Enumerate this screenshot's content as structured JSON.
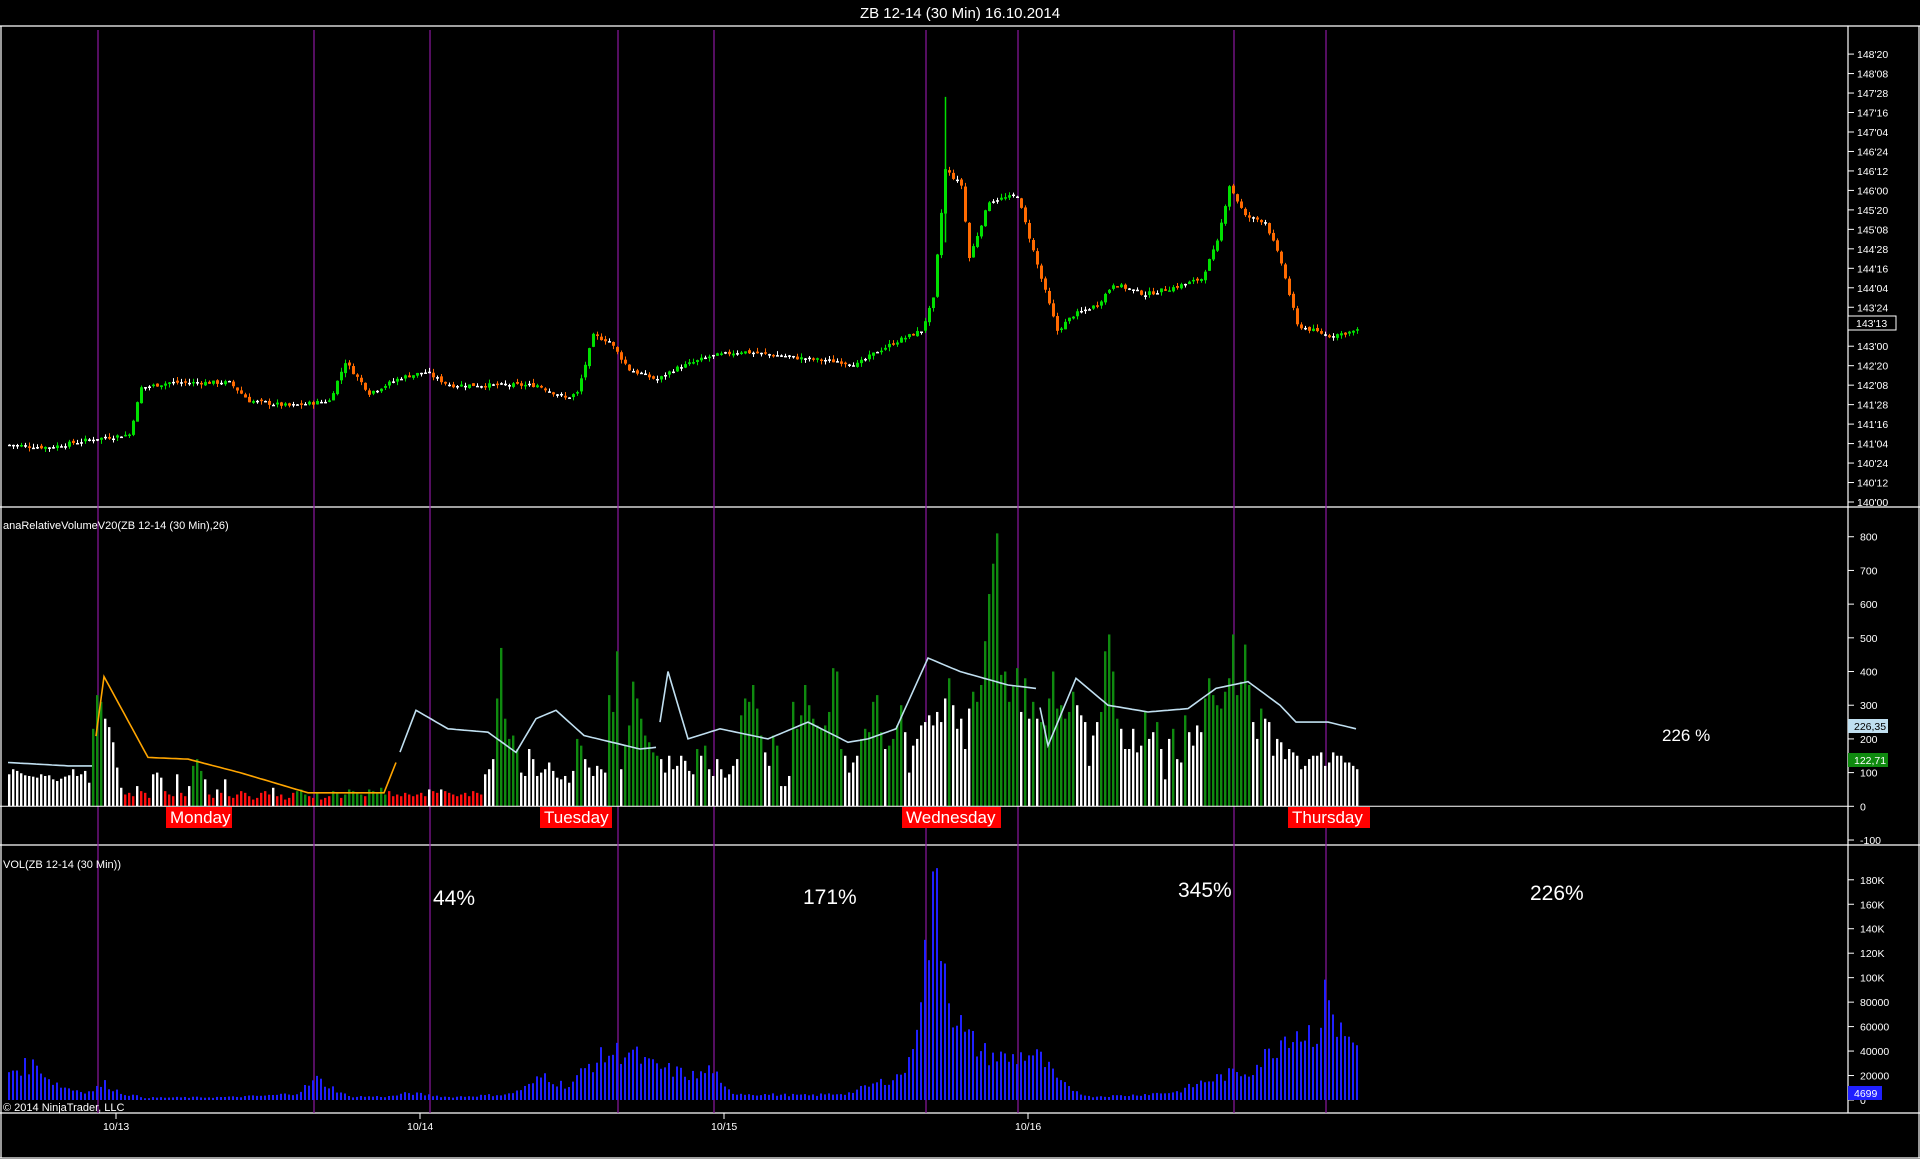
{
  "window": {
    "title": "ZB 12-14 (30 Min)  16.10.2014"
  },
  "copyright": "© 2014 NinjaTrader, LLC",
  "colors": {
    "background": "#000000",
    "up_candle": "#00e000",
    "down_candle": "#ff6a00",
    "flat_candle": "#ffffff",
    "session_line": "#8b18a0",
    "rel_vol_high": "#0f8a0f",
    "rel_vol_low": "#ff1010",
    "rel_vol_mid": "#ffffff",
    "rel_vol_avg_line": "#c0dff0",
    "rel_vol_avg_line_low": "#ffa500",
    "volume_bar": "#2020ff",
    "day_badge": "#ff0000"
  },
  "panels": {
    "price": {
      "last_price_badge": "143'13"
    },
    "relative_volume": {
      "label": "anaRelativeVolumeV20(ZB 12-14 (30 Min),26)",
      "avg_badge": "226,35",
      "value_badge": "122,71",
      "right_annotation": "226 %"
    },
    "volume": {
      "label": "VOL(ZB 12-14 (30 Min))",
      "last_badge": "4699"
    }
  },
  "days": [
    "Monday",
    "Tuesday",
    "Wednesday",
    "Thursday"
  ],
  "percent_annotations": [
    "44%",
    "171%",
    "345%",
    "226%"
  ],
  "chart_data": [
    {
      "type": "candlestick",
      "title": "ZB 12-14 (30 Min)  16.10.2014",
      "y_ticks": [
        "140'00",
        "140'12",
        "140'24",
        "141'04",
        "141'16",
        "141'28",
        "142'08",
        "142'20",
        "143'00",
        "143'12",
        "143'24",
        "144'04",
        "144'16",
        "144'28",
        "145'08",
        "145'20",
        "146'00",
        "146'12",
        "146'24",
        "147'04",
        "147'16",
        "147'28",
        "148'08",
        "148'20"
      ],
      "x_ticks": [
        "10/13",
        "10/14",
        "10/15",
        "10/16"
      ],
      "ylim": [
        140.0,
        148.8
      ],
      "last_price": "143'13",
      "close_path": [
        [
          0,
          141.1
        ],
        [
          10,
          141.05
        ],
        [
          20,
          141.2
        ],
        [
          30,
          141.3
        ],
        [
          33,
          142.2
        ],
        [
          40,
          142.3
        ],
        [
          55,
          142.3
        ],
        [
          60,
          141.95
        ],
        [
          70,
          141.85
        ],
        [
          80,
          141.95
        ],
        [
          84,
          142.7
        ],
        [
          90,
          142.1
        ],
        [
          98,
          142.4
        ],
        [
          104,
          142.5
        ],
        [
          110,
          142.25
        ],
        [
          120,
          142.25
        ],
        [
          132,
          142.25
        ],
        [
          139,
          142.0
        ],
        [
          142,
          142.1
        ],
        [
          146,
          143.2
        ],
        [
          150,
          143.1
        ],
        [
          155,
          142.55
        ],
        [
          162,
          142.35
        ],
        [
          166,
          142.55
        ],
        [
          175,
          142.8
        ],
        [
          183,
          142.9
        ],
        [
          200,
          142.75
        ],
        [
          208,
          142.7
        ],
        [
          212,
          142.65
        ],
        [
          217,
          142.9
        ],
        [
          222,
          143.1
        ],
        [
          228,
          143.3
        ],
        [
          231,
          143.9
        ],
        [
          234,
          146.4
        ],
        [
          238,
          146.1
        ],
        [
          240,
          144.7
        ],
        [
          245,
          145.8
        ],
        [
          252,
          145.9
        ],
        [
          255,
          145.1
        ],
        [
          258,
          144.3
        ],
        [
          262,
          143.3
        ],
        [
          266,
          143.6
        ],
        [
          272,
          143.8
        ],
        [
          276,
          144.2
        ],
        [
          284,
          144.0
        ],
        [
          292,
          144.15
        ],
        [
          298,
          144.3
        ],
        [
          302,
          145.0
        ],
        [
          305,
          146.1
        ],
        [
          309,
          145.5
        ],
        [
          314,
          145.4
        ],
        [
          318,
          144.6
        ],
        [
          322,
          143.4
        ],
        [
          330,
          143.2
        ],
        [
          337,
          143.3
        ]
      ],
      "session_start_bars": [
        22,
        76,
        105,
        152,
        176,
        229,
        252,
        306,
        329
      ]
    },
    {
      "type": "bar",
      "title": "anaRelativeVolumeV20(ZB 12-14 (30 Min),26)",
      "y_ticks": [
        "800",
        "700",
        "600",
        "500",
        "400",
        "300",
        "200",
        "100",
        "0",
        "-100"
      ],
      "ylim": [
        -100,
        820
      ],
      "series": [
        {
          "name": "anaRelativeVolumeV20(ZB 12-14 (30 Min),26)",
          "segments": [
            [
              0,
              [
                95,
                110,
                105,
                98,
                92,
                90,
                88,
                85,
                95,
                90,
                92,
                80,
                75,
                82,
                88,
                92,
                110,
                90,
                95,
                105,
                70,
                230,
                330,
                310,
                260,
                235,
                190,
                115,
                55,
                35
              ]
            ],
            [
              30,
              [
                40,
                30,
                60,
                45,
                40,
                25,
                95,
                100,
                85,
                45,
                35,
                30,
                95,
                40,
                30,
                60,
                120,
                140,
                105,
                80,
                35,
                25,
                50,
                40,
                80,
                30,
                25,
                35,
                45,
                40
              ]
            ],
            [
              60,
              [
                30,
                20,
                25,
                40,
                45,
                35,
                55,
                30,
                35,
                20,
                25,
                40,
                45,
                50,
                35,
                30,
                25,
                40,
                20,
                25,
                30,
                45,
                40,
                25,
                35,
                50,
                45,
                40,
                35,
                30
              ]
            ],
            [
              90,
              [
                50,
                45,
                40,
                55,
                35,
                45,
                30,
                35,
                30,
                40,
                35,
                30,
                35,
                40,
                30,
                50,
                45,
                40,
                50,
                45,
                40,
                35,
                30,
                35,
                40,
                30,
                45,
                40,
                35,
                95
              ]
            ],
            [
              120,
              [
                110,
                140,
                320,
                470,
                260,
                200,
                210,
                170,
                100,
                90,
                170,
                140,
                90,
                100,
                110,
                130,
                105,
                85,
                80,
                90,
                70,
                105,
                200,
                180,
                140,
                115,
                90,
                120,
                110,
                100
              ]
            ],
            [
              150,
              [
                330,
                280,
                460,
                110,
                180,
                240,
                370,
                320,
                260,
                210,
                190,
                160,
                150,
                140,
                100,
                150,
                110,
                120,
                150,
                135,
                105,
                95,
                170,
                150,
                180,
                110,
                90,
                140,
                110,
                85
              ]
            ],
            [
              180,
              [
                95,
                120,
                140,
                270,
                320,
                310,
                360,
                290,
                210,
                160,
                120,
                210,
                180,
                60,
                60,
                90,
                310,
                230,
                270,
                360,
                300,
                260,
                240,
                230,
                240,
                280,
                410,
                400,
                170,
                150
              ]
            ],
            [
              210,
              [
                100,
                130,
                150,
                200,
                230,
                220,
                310,
                330,
                220,
                170,
                180,
                200,
                240,
                300,
                220,
                100,
                180,
                200,
                240,
                250,
                270,
                240,
                280,
                250,
                320,
                380,
                300,
                230,
                260,
                170
              ]
            ],
            [
              240,
              [
                290,
                340,
                310,
                360,
                490,
                630,
                720,
                810,
                390,
                400,
                310,
                360,
                410,
                280,
                380,
                260,
                310,
                260,
                250,
                240,
                320,
                400,
                290,
                300,
                260,
                280,
                340,
                300,
                270,
                250
              ]
            ],
            [
              270,
              [
                120,
                210,
                250,
                280,
                460,
                510,
                400,
                260,
                230,
                170,
                170,
                230,
                160,
                180,
                280,
                200,
                220,
                250,
                170,
                80,
                200,
                230,
                140,
                130,
                270,
                220,
                180,
                240,
                220,
                320
              ]
            ],
            [
              300,
              [
                380,
                330,
                300,
                290,
                340,
                380,
                510,
                330,
                370,
                480,
                360,
                250,
                200,
                290,
                260,
                250,
                150,
                200,
                190,
                140,
                170,
                160,
                150,
                110,
                120,
                140,
                150,
                150,
                160,
                120
              ]
            ],
            [
              330,
              [
                130,
                160,
                150,
                150,
                130,
                130,
                120,
                110
              ]
            ]
          ]
        },
        {
          "name": "avg",
          "points": [
            [
              0,
              130
            ],
            [
              15,
              120
            ],
            [
              21,
              120
            ],
            [
              24,
              385
            ],
            [
              35,
              145
            ],
            [
              45,
              140
            ],
            [
              58,
              100
            ],
            [
              75,
              40
            ],
            [
              94,
              40
            ],
            [
              97,
              130
            ],
            [
              102,
              285
            ],
            [
              110,
              230
            ],
            [
              120,
              220
            ],
            [
              127,
              160
            ],
            [
              132,
              260
            ],
            [
              137,
              285
            ],
            [
              144,
              210
            ],
            [
              158,
              170
            ],
            [
              162,
              175
            ],
            [
              165,
              400
            ],
            [
              170,
              200
            ],
            [
              178,
              230
            ],
            [
              190,
              200
            ],
            [
              200,
              250
            ],
            [
              210,
              190
            ],
            [
              215,
              200
            ],
            [
              222,
              230
            ],
            [
              230,
              440
            ],
            [
              238,
              400
            ],
            [
              250,
              360
            ],
            [
              257,
              350
            ],
            [
              260,
              180
            ],
            [
              267,
              380
            ],
            [
              275,
              300
            ],
            [
              285,
              280
            ],
            [
              295,
              290
            ],
            [
              302,
              350
            ],
            [
              310,
              370
            ],
            [
              318,
              300
            ],
            [
              322,
              250
            ],
            [
              330,
              250
            ],
            [
              337,
              230
            ]
          ]
        }
      ]
    },
    {
      "type": "bar",
      "title": "VOL(ZB 12-14 (30 Min))",
      "y_ticks": [
        "180K",
        "160K",
        "140K",
        "120K",
        "100K",
        "80000",
        "60000",
        "40000",
        "20000",
        "0"
      ],
      "ylim": [
        0,
        188000
      ],
      "values_by_bar": [
        [
          0,
          25000
        ],
        [
          3,
          28000
        ],
        [
          6,
          30000
        ],
        [
          8,
          28000
        ],
        [
          10,
          18000
        ],
        [
          13,
          12000
        ],
        [
          16,
          9000
        ],
        [
          20,
          7000
        ],
        [
          24,
          14000
        ],
        [
          28,
          6000
        ],
        [
          34,
          2000
        ],
        [
          55,
          2500
        ],
        [
          66,
          4000
        ],
        [
          72,
          6000
        ],
        [
          77,
          18000
        ],
        [
          80,
          12000
        ],
        [
          85,
          3000
        ],
        [
          95,
          3000
        ],
        [
          100,
          6000
        ],
        [
          110,
          2500
        ],
        [
          125,
          5000
        ],
        [
          130,
          12000
        ],
        [
          134,
          22000
        ],
        [
          137,
          15000
        ],
        [
          140,
          12000
        ],
        [
          145,
          30000
        ],
        [
          150,
          40000
        ],
        [
          155,
          42000
        ],
        [
          160,
          30000
        ],
        [
          166,
          25000
        ],
        [
          172,
          20000
        ],
        [
          176,
          28000
        ],
        [
          178,
          12000
        ],
        [
          181,
          6000
        ],
        [
          186,
          5000
        ],
        [
          200,
          4000
        ],
        [
          210,
          6000
        ],
        [
          215,
          12000
        ],
        [
          222,
          20000
        ],
        [
          225,
          30000
        ],
        [
          228,
          100000
        ],
        [
          230,
          140000
        ],
        [
          232,
          185000
        ],
        [
          234,
          120000
        ],
        [
          236,
          80000
        ],
        [
          239,
          55000
        ],
        [
          244,
          40000
        ],
        [
          250,
          35000
        ],
        [
          255,
          40000
        ],
        [
          258,
          35000
        ],
        [
          263,
          14000
        ],
        [
          270,
          3000
        ],
        [
          280,
          4000
        ],
        [
          292,
          7000
        ],
        [
          298,
          15000
        ],
        [
          305,
          22000
        ],
        [
          310,
          25000
        ],
        [
          315,
          40000
        ],
        [
          320,
          60000
        ],
        [
          325,
          58000
        ],
        [
          328,
          62000
        ],
        [
          330,
          105000
        ],
        [
          332,
          60000
        ],
        [
          336,
          50000
        ],
        [
          340,
          35000
        ],
        [
          345,
          30000
        ],
        [
          350,
          25000
        ],
        [
          356,
          15000
        ],
        [
          360,
          8000
        ]
      ],
      "last_value": "4699"
    }
  ]
}
